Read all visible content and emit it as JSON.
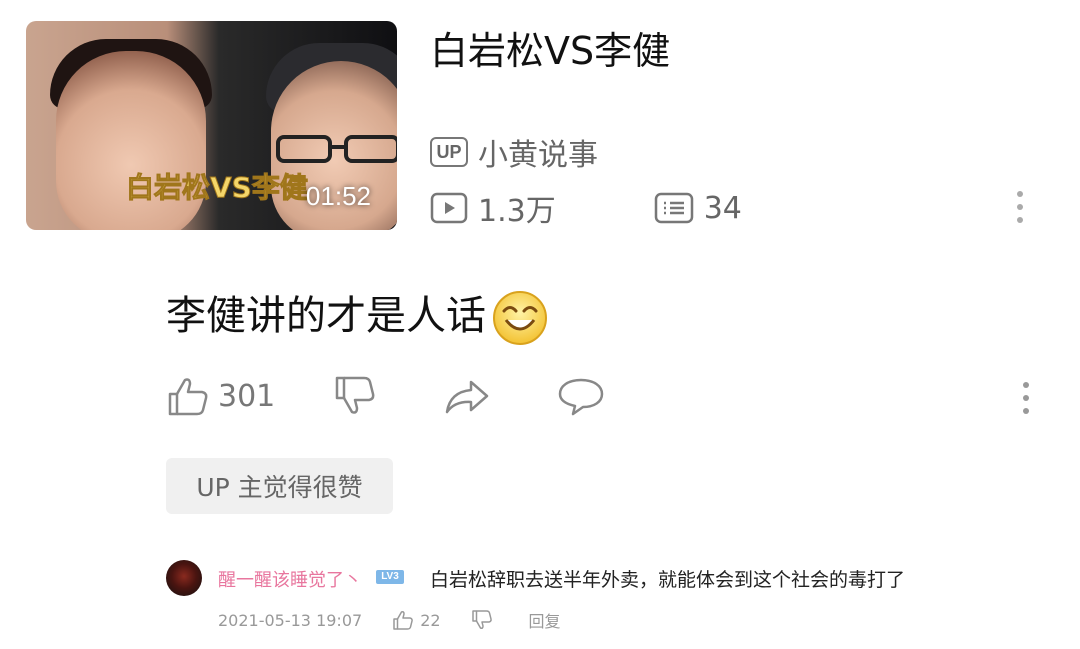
{
  "video": {
    "thumbnail_overlay_text": "白岩松VS李健",
    "duration": "01:52",
    "title": "白岩松VS李健",
    "uploader_badge": "UP",
    "uploader_name": "小黄说事",
    "views": "1.3万",
    "danmaku_count": "34"
  },
  "comment": {
    "text": "李健讲的才是人话",
    "emoji_icon": "grinning-squint-emoji",
    "likes": "301"
  },
  "up_like_label": "UP 主觉得很赞",
  "reply": {
    "username": "醒一醒该睡觉了丶",
    "level": "LV3",
    "text": "白岩松辞职去送半年外卖，就能体会到这个社会的毒打了",
    "timestamp": "2021-05-13 19:07",
    "likes": "22",
    "reply_label": "回复"
  },
  "colors": {
    "username_pink": "#e8769e",
    "level_blue": "#7eb7e8",
    "muted_text": "#666666"
  }
}
